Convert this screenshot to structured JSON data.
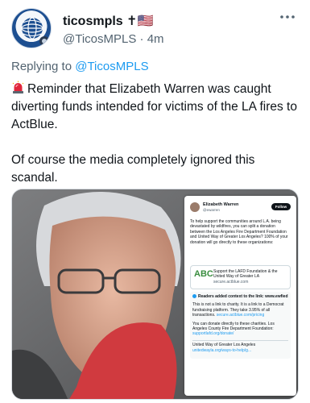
{
  "author": {
    "display_name": "ticosmpls ✝🇺🇸",
    "handle": "@TicosMPLS",
    "separator": "·",
    "time": "4m"
  },
  "more_icon": "more-horizontal-icon",
  "reply_context": {
    "prefix": "Replying to",
    "mention": "@TicosMPLS"
  },
  "tweet": {
    "emoji_icon": "police-siren-icon",
    "line1": "Reminder that Elizabeth Warren was caught diverting funds intended for victims of the LA fires to ActBlue.",
    "line2": "Of course the media completely ignored this scandal."
  },
  "embedded_post": {
    "name": "Elizabeth Warren",
    "handle": "@ewarren",
    "follow_label": "Follow",
    "body": "To help support the communities around L.A. being devastated by wildfires, you can split a donation between the Los Angeles Fire Department Foundation and United Way of Greater Los Angeles? 100% of your donation will go directly to these organizations:",
    "card_logo": "ABC",
    "card_title": "Support the LAFD Foundation & the United Way of Greater LA",
    "card_url": "secure.actblue.com",
    "note_heading": "Readers added context to the link: www.ewfied",
    "note_p1": "This is not a link to charity. It is a link to a Democrat fundraising platform. They take 3.95% of all transactions.",
    "note_p1_link": "secure.actblue.com/pricing",
    "note_p2": "You can donate directly to these charities. Los Angeles County Fire Department Foundation:",
    "note_p2_link": "supportlafd.org/donate/",
    "note_p3": "United Way of Greater Los Angeles",
    "note_p3_link": "unitedwayla.org/ways-to-help/g..."
  },
  "colors": {
    "link_blue": "#1d9bf0",
    "secondary_text": "#536471",
    "primary_text": "#0f1419"
  }
}
